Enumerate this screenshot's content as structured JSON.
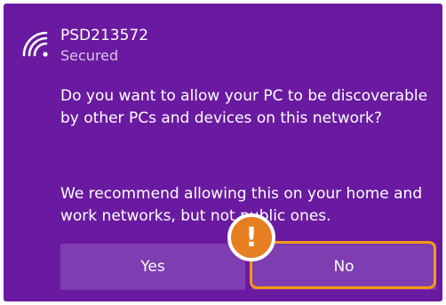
{
  "network": {
    "name": "PSD213572",
    "status": "Secured",
    "icon": "wifi-icon"
  },
  "dialog": {
    "question": "Do you want to allow your PC to be discoverable by other PCs and devices on this network?",
    "recommendation": "We recommend allowing this on your home and work networks, but not public ones."
  },
  "buttons": {
    "yes_label": "Yes",
    "no_label": "No"
  },
  "annotation": {
    "badge_text": "!",
    "highlight_color": "#f39c12",
    "badge_color": "#e67e22"
  },
  "colors": {
    "panel_bg": "#6a1aa0",
    "button_bg": "#7e3db0",
    "secondary_text": "#d8c5e8"
  }
}
